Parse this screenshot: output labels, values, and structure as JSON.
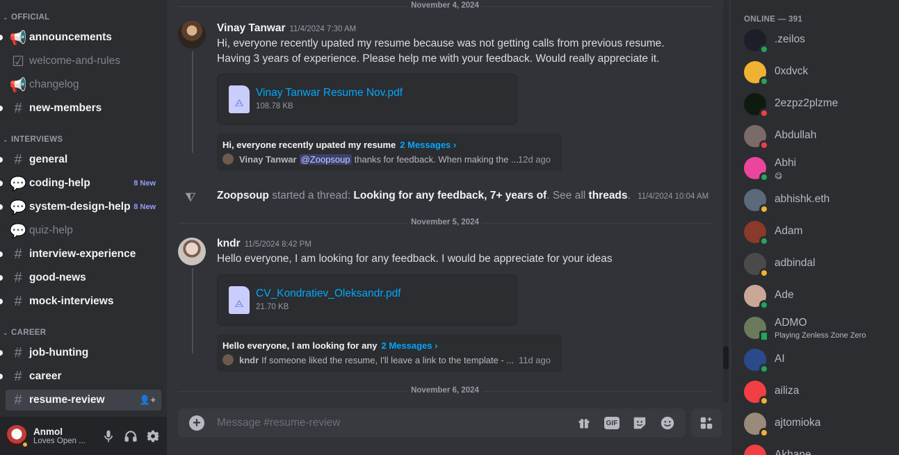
{
  "sidebar": {
    "categories": [
      {
        "label": "OFFICIAL"
      },
      {
        "label": "INTERVIEWS"
      },
      {
        "label": "CAREER"
      }
    ],
    "channels": [
      {
        "name": "announcements",
        "icon": "megaphone-icon",
        "glyph": "📢",
        "style": "unread"
      },
      {
        "name": "welcome-and-rules",
        "icon": "rules-icon",
        "glyph": "☑",
        "style": "muted"
      },
      {
        "name": "changelog",
        "icon": "megaphone-icon",
        "glyph": "📢",
        "style": "muted"
      },
      {
        "name": "new-members",
        "icon": "hash-icon",
        "glyph": "#",
        "style": "unread"
      },
      {
        "name": "general",
        "icon": "hash-icon",
        "glyph": "#",
        "style": "unread"
      },
      {
        "name": "coding-help",
        "icon": "forum-icon",
        "glyph": "💬",
        "style": "unread",
        "badge": "8 New"
      },
      {
        "name": "system-design-help",
        "icon": "forum-icon",
        "glyph": "💬",
        "style": "unread",
        "badge": "8 New"
      },
      {
        "name": "quiz-help",
        "icon": "forum-icon",
        "glyph": "💬",
        "style": "muted"
      },
      {
        "name": "interview-experience",
        "icon": "hash-icon",
        "glyph": "#",
        "style": "unread"
      },
      {
        "name": "good-news",
        "icon": "hash-icon",
        "glyph": "#",
        "style": "unread"
      },
      {
        "name": "mock-interviews",
        "icon": "hash-icon",
        "glyph": "#",
        "style": "unread"
      },
      {
        "name": "job-hunting",
        "icon": "hash-icon",
        "glyph": "#",
        "style": "unread"
      },
      {
        "name": "career",
        "icon": "hash-icon",
        "glyph": "#",
        "style": "unread"
      },
      {
        "name": "resume-review",
        "icon": "hash-icon",
        "glyph": "#",
        "style": "active"
      }
    ]
  },
  "user": {
    "name": "Anmol",
    "status": "Loves Open ...",
    "mic_icon": "mic-icon",
    "headphones_icon": "headphones-icon",
    "settings_icon": "gear-icon"
  },
  "chat": {
    "dividers": [
      "November 4, 2024",
      "November 5, 2024",
      "November 6, 2024"
    ],
    "messages": [
      {
        "author": "Vinay Tanwar",
        "timestamp": "11/4/2024 7:30 AM",
        "lines": [
          "Hi, everyone recently upated my resume because was not getting calls from previous resume.",
          "Having 3 years of experience.  Please help me with your feedback.  Would really appreciate it."
        ],
        "attachment": {
          "name": "Vinay Tanwar Resume Nov.pdf",
          "size": "108.78 KB"
        },
        "thread": {
          "title": "Hi, everyone recently upated my resume",
          "count": "2 Messages ›",
          "last_author": "Vinay Tanwar",
          "mention": "@Zoopsoup",
          "last_text": "thanks for feedback. When making the ...",
          "ago": "12d ago"
        }
      },
      {
        "author": "kndr",
        "timestamp": "11/5/2024 8:42 PM",
        "lines": [
          "Hello everyone, I am looking for any feedback. I would be appreciate for your ideas"
        ],
        "attachment": {
          "name": "CV_Kondratiev_Oleksandr.pdf",
          "size": "21.70 KB"
        },
        "thread": {
          "title": "Hello everyone, I am looking for any",
          "count": "2 Messages ›",
          "last_author": "kndr",
          "last_text": "If someone liked the resume, I'll leave a link to the template - ...",
          "ago": "11d ago"
        }
      }
    ],
    "system": {
      "actor": "Zoopsoup",
      "action": "started a thread:",
      "thread_name": "Looking for any feedback, 7+ years of",
      "see_all": ". See all",
      "threads_link": "threads",
      "end": ".",
      "timestamp": "11/4/2024 10:04 AM"
    },
    "composer": {
      "placeholder": "Message #resume-review",
      "gif_label": "GIF"
    }
  },
  "members": {
    "header": "ONLINE — 391",
    "list": [
      {
        "name": ".zeilos",
        "status": "online",
        "color": "#1e1e2a"
      },
      {
        "name": "0xdvck",
        "status": "online",
        "color": "#f0b232"
      },
      {
        "name": "2ezpz2plzme",
        "status": "dnd",
        "color": "#0d1a0d"
      },
      {
        "name": "Abdullah",
        "status": "dnd",
        "color": "#7a6a6a"
      },
      {
        "name": "Abhi",
        "status": "online",
        "color": "#eb459e",
        "sub": "😋"
      },
      {
        "name": "abhishk.eth",
        "status": "idle",
        "color": "#5a6a7a"
      },
      {
        "name": "Adam",
        "status": "online",
        "color": "#8a3a2a"
      },
      {
        "name": "adbindal",
        "status": "idle",
        "color": "#4a4a4a"
      },
      {
        "name": "Ade",
        "status": "online",
        "color": "#c9a898"
      },
      {
        "name": "ADMO",
        "status": "mobile",
        "color": "#6a7a5a",
        "sub": "Playing Zenless Zone Zero"
      },
      {
        "name": "AI",
        "status": "online",
        "color": "#2a4a8a"
      },
      {
        "name": "ailiza",
        "status": "idle",
        "color": "#f23f43"
      },
      {
        "name": "ajtomioka",
        "status": "idle",
        "color": "#9a8a7a"
      },
      {
        "name": "Akhane...",
        "status": "online",
        "color": "#f23f43"
      }
    ]
  },
  "colors": {
    "online": "#23a55a",
    "idle": "#f0b232",
    "dnd": "#f23f43",
    "link": "#00a8fc",
    "new_badge": "#949cf7"
  }
}
